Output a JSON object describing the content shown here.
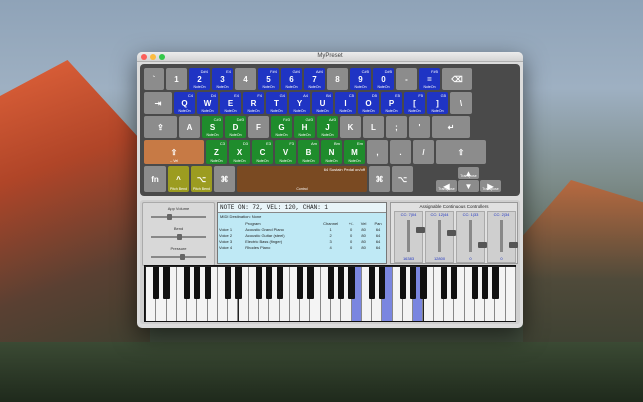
{
  "window": {
    "title": "MyPreset"
  },
  "keyboard": {
    "rows": [
      [
        {
          "c": "`"
        },
        {
          "c": "1"
        },
        {
          "c": "2",
          "n": "D#4",
          "l": "NoteOn",
          "k": "blue"
        },
        {
          "c": "3",
          "n": "E4",
          "l": "NoteOn",
          "k": "blue"
        },
        {
          "c": "4"
        },
        {
          "c": "5",
          "n": "F#4",
          "l": "NoteOn",
          "k": "blue"
        },
        {
          "c": "6",
          "n": "G#4",
          "l": "NoteOn",
          "k": "blue"
        },
        {
          "c": "7",
          "n": "A#4",
          "l": "NoteOn",
          "k": "blue"
        },
        {
          "c": "8"
        },
        {
          "c": "9",
          "n": "C#5",
          "l": "NoteOn",
          "k": "blue"
        },
        {
          "c": "0",
          "n": "D#5",
          "l": "NoteOn",
          "k": "blue"
        },
        {
          "c": "-"
        },
        {
          "c": "=",
          "n": "F#5",
          "l": "NoteOn",
          "k": "blue"
        },
        {
          "c": "⌫"
        }
      ],
      [
        {
          "c": "⇥"
        },
        {
          "c": "Q",
          "n": "C4",
          "l": "NoteOn",
          "k": "blue"
        },
        {
          "c": "W",
          "n": "D4",
          "l": "NoteOn",
          "k": "blue"
        },
        {
          "c": "E",
          "n": "E4",
          "l": "NoteOn",
          "k": "blue"
        },
        {
          "c": "R",
          "n": "F4",
          "l": "NoteOn",
          "k": "blue"
        },
        {
          "c": "T",
          "n": "G4",
          "l": "NoteOn",
          "k": "blue"
        },
        {
          "c": "Y",
          "n": "A4",
          "l": "NoteOn",
          "k": "blue"
        },
        {
          "c": "U",
          "n": "B4",
          "l": "NoteOn",
          "k": "blue"
        },
        {
          "c": "I",
          "n": "C5",
          "l": "NoteOn",
          "k": "blue"
        },
        {
          "c": "O",
          "n": "D5",
          "l": "NoteOn",
          "k": "blue"
        },
        {
          "c": "P",
          "n": "E5",
          "l": "NoteOn",
          "k": "blue"
        },
        {
          "c": "[",
          "n": "F5",
          "l": "NoteOn",
          "k": "blue"
        },
        {
          "c": "]",
          "n": "G5",
          "l": "NoteOn",
          "k": "blue"
        },
        {
          "c": "\\"
        }
      ],
      [
        {
          "c": "⇪"
        },
        {
          "c": "A"
        },
        {
          "c": "S",
          "n": "C#3",
          "l": "NoteOn",
          "k": "green"
        },
        {
          "c": "D",
          "n": "D#3",
          "l": "NoteOn",
          "k": "green"
        },
        {
          "c": "F"
        },
        {
          "c": "G",
          "n": "F#3",
          "l": "NoteOn",
          "k": "green"
        },
        {
          "c": "H",
          "n": "G#3",
          "l": "NoteOn",
          "k": "green"
        },
        {
          "c": "J",
          "n": "A#3",
          "l": "NoteOn",
          "k": "green"
        },
        {
          "c": "K"
        },
        {
          "c": "L"
        },
        {
          "c": ";"
        },
        {
          "c": "'"
        },
        {
          "c": "↵"
        }
      ],
      [
        {
          "c": "⇧",
          "l": "-- Vel",
          "k": "orange"
        },
        {
          "c": "Z",
          "n": "C3",
          "l": "NoteOn",
          "k": "green"
        },
        {
          "c": "X",
          "n": "D3",
          "l": "NoteOn",
          "k": "green"
        },
        {
          "c": "C",
          "n": "E3",
          "l": "NoteOn",
          "k": "green"
        },
        {
          "c": "V",
          "n": "F3",
          "l": "NoteOn",
          "k": "green"
        },
        {
          "c": "B",
          "n": "Am",
          "l": "NoteOn",
          "k": "green"
        },
        {
          "c": "N",
          "n": "Bm",
          "l": "NoteOn",
          "k": "green"
        },
        {
          "c": "M",
          "n": "Em",
          "l": "NoteOn",
          "k": "green"
        },
        {
          "c": ","
        },
        {
          "c": "."
        },
        {
          "c": "/"
        },
        {
          "c": "⇧"
        }
      ],
      [
        {
          "c": "fn"
        },
        {
          "c": "^",
          "l": "Pitch Bend",
          "k": "olive"
        },
        {
          "c": "⌥",
          "l": "Pitch Bend",
          "k": "olive"
        },
        {
          "c": "⌘"
        },
        {
          "c": "",
          "l": "Control",
          "k": "brown",
          "t": "64 Sustain Pedal on/off"
        },
        {
          "c": "⌘"
        },
        {
          "c": "⌥"
        },
        {
          "c": "▲",
          "l": "Transpose"
        },
        {
          "c": "◀",
          "l": "Transpose"
        },
        {
          "c": "▼"
        },
        {
          "c": "▶",
          "l": "Transpose"
        }
      ]
    ]
  },
  "sliders": [
    {
      "label": "App Volume",
      "pos": 0.3
    },
    {
      "label": "Bend",
      "pos": 0.5
    },
    {
      "label": "Pressure",
      "pos": 0.55
    }
  ],
  "midi": {
    "status": "NOTE ON: 72, VEL: 120, CHAN: 1",
    "destination": "MIDI Destination: None",
    "headers": [
      "",
      "Program",
      "Channel",
      "+/-",
      "Vel",
      "Pan"
    ],
    "rows": [
      [
        "Voice 1",
        "Acoustic Grand Piano",
        "1",
        "0",
        "80",
        "64"
      ],
      [
        "Voice 2",
        "Acoustic Guitar (steel)",
        "2",
        "0",
        "80",
        "64"
      ],
      [
        "Voice 3",
        "Electric Bass (finger)",
        "3",
        "0",
        "80",
        "64"
      ],
      [
        "Voice 4",
        "Rhodes Piano",
        "4",
        "0",
        "80",
        "64"
      ]
    ]
  },
  "cc": {
    "title": "Assignable Continuous Controllers",
    "controls": [
      {
        "label": "CC: 7|04",
        "value": "16383",
        "pos": 0.25
      },
      {
        "label": "CC: 12|44",
        "value": "12800",
        "pos": 0.4
      },
      {
        "label": "CC: 1|33",
        "value": "0",
        "pos": 0.85
      },
      {
        "label": "CC: 2|34",
        "value": "0",
        "pos": 0.85
      }
    ]
  },
  "piano": {
    "active": [
      20,
      23,
      26
    ]
  },
  "colors": {
    "blue": "#1f34c4",
    "green": "#1f8c2c",
    "orange": "#c77a45",
    "olive": "#9c9c20"
  }
}
